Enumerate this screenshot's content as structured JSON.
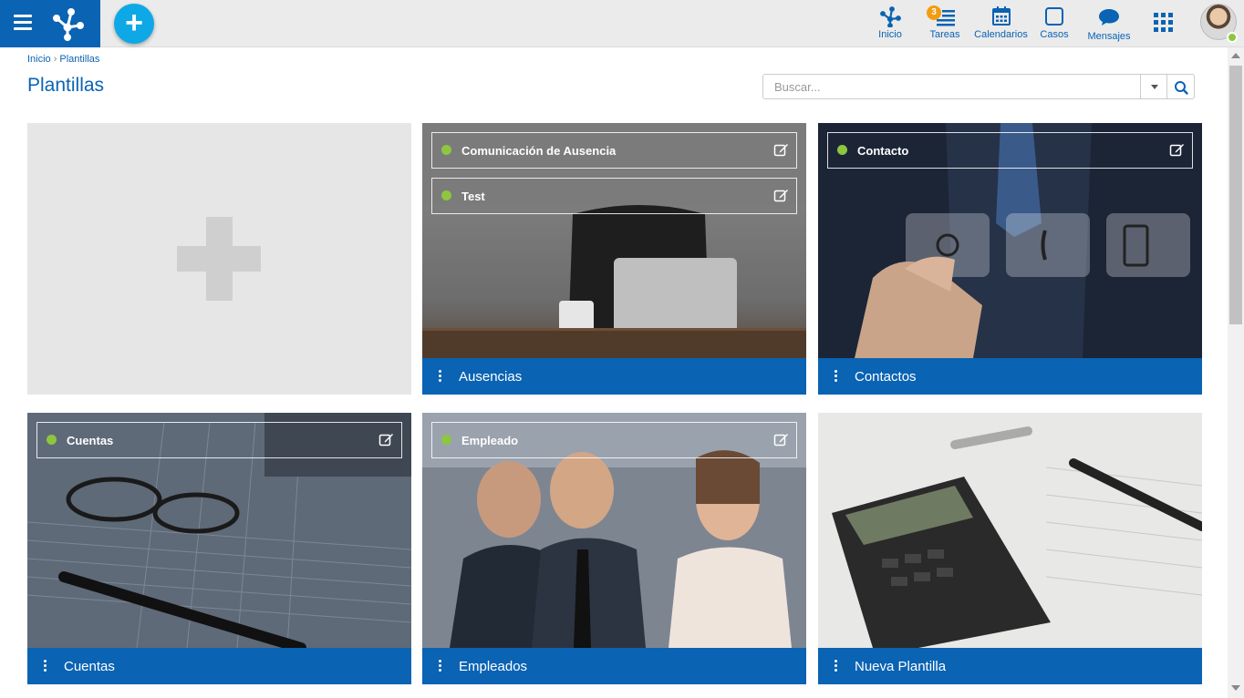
{
  "topbar": {
    "nav": [
      {
        "key": "inicio",
        "label": "Inicio",
        "icon": "home-network-icon"
      },
      {
        "key": "tareas",
        "label": "Tareas",
        "icon": "tasks-icon",
        "badge": "3"
      },
      {
        "key": "calendarios",
        "label": "Calendarios",
        "icon": "calendar-icon"
      },
      {
        "key": "casos",
        "label": "Casos",
        "icon": "cases-icon"
      },
      {
        "key": "mensajes",
        "label": "Mensajes",
        "icon": "message-icon"
      }
    ],
    "fab_label": "+",
    "accent": "#0a63b3",
    "fab_color": "#0fa8e6",
    "status_color": "#8dc63f"
  },
  "breadcrumb": {
    "home": "Inicio",
    "separator": "›",
    "current": "Plantillas"
  },
  "page_title": "Plantillas",
  "search": {
    "placeholder": "Buscar..."
  },
  "cards": [
    {
      "name": "Ausencias",
      "templates": [
        "Comunicación de Ausencia",
        "Test"
      ]
    },
    {
      "name": "Contactos",
      "templates": [
        "Contacto"
      ]
    },
    {
      "name": "Cuentas",
      "templates": [
        "Cuentas"
      ]
    },
    {
      "name": "Empleados",
      "templates": [
        "Empleado"
      ]
    },
    {
      "name": "Nueva Plantilla",
      "templates": []
    }
  ]
}
